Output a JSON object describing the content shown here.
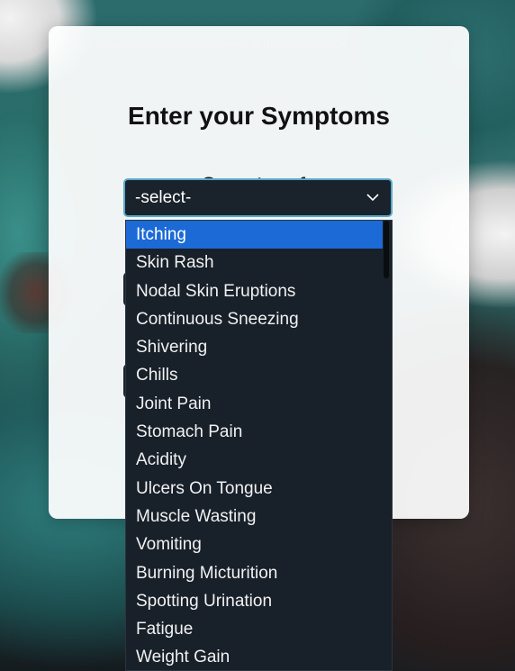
{
  "form": {
    "title": "Enter your Symptoms",
    "symptom_label": "Symptom 1:",
    "select_value": "-select-"
  },
  "dropdown": {
    "selected_index": 0,
    "options": [
      "Itching",
      "Skin Rash",
      "Nodal Skin Eruptions",
      "Continuous Sneezing",
      "Shivering",
      "Chills",
      "Joint Pain",
      "Stomach Pain",
      "Acidity",
      "Ulcers On Tongue",
      "Muscle Wasting",
      "Vomiting",
      "Burning Micturition",
      "Spotting Urination",
      "Fatigue",
      "Weight Gain"
    ]
  },
  "colors": {
    "highlight": "#1c6ad6",
    "select_border": "#58a9c9",
    "dropdown_bg": "#18202a"
  }
}
